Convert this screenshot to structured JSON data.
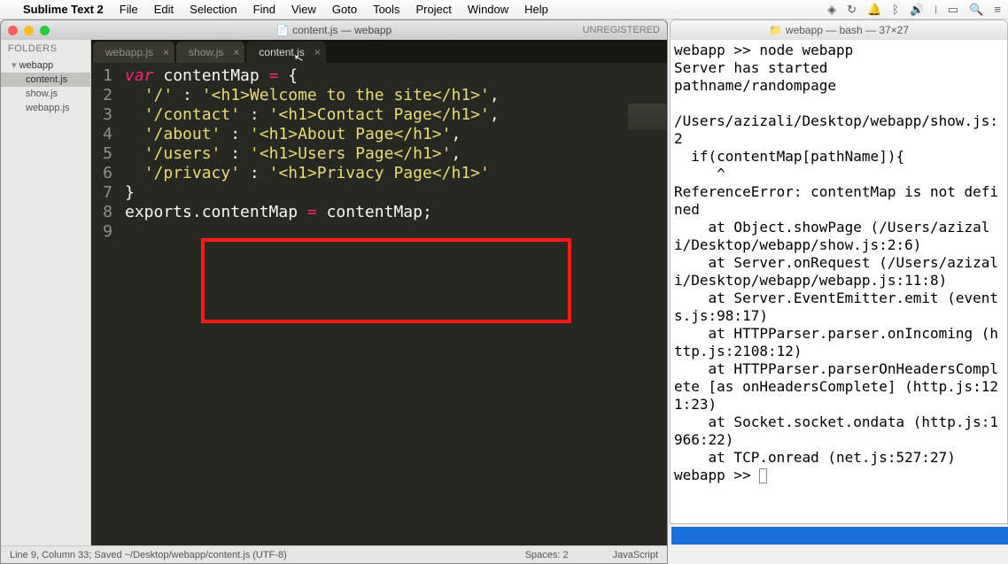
{
  "menubar": {
    "appname": "Sublime Text 2",
    "items": [
      "File",
      "Edit",
      "Selection",
      "Find",
      "View",
      "Goto",
      "Tools",
      "Project",
      "Window",
      "Help"
    ]
  },
  "editor": {
    "title": "content.js — webapp",
    "unregistered": "UNREGISTERED",
    "sidebar": {
      "header": "FOLDERS",
      "folder": "webapp",
      "files": [
        "content.js",
        "show.js",
        "webapp.js"
      ],
      "active_file": "content.js"
    },
    "tabs": [
      {
        "label": "webapp.js",
        "active": false
      },
      {
        "label": "show.js",
        "active": false
      },
      {
        "label": "content.js",
        "active": true
      }
    ],
    "line_numbers": [
      "1",
      "2",
      "3",
      "4",
      "5",
      "6",
      "7",
      "8",
      "9"
    ],
    "code_lines": [
      [
        {
          "c": "kw",
          "t": "var"
        },
        {
          "c": "plain",
          "t": " contentMap "
        },
        {
          "c": "op",
          "t": "="
        },
        {
          "c": "plain",
          "t": " {"
        }
      ],
      [
        {
          "c": "plain",
          "t": "  "
        },
        {
          "c": "str",
          "t": "'/'"
        },
        {
          "c": "plain",
          "t": " : "
        },
        {
          "c": "str",
          "t": "'<h1>Welcome to the site</h1>'"
        },
        {
          "c": "plain",
          "t": ","
        }
      ],
      [
        {
          "c": "plain",
          "t": "  "
        },
        {
          "c": "str",
          "t": "'/contact'"
        },
        {
          "c": "plain",
          "t": " : "
        },
        {
          "c": "str",
          "t": "'<h1>Contact Page</h1>'"
        },
        {
          "c": "plain",
          "t": ","
        }
      ],
      [
        {
          "c": "plain",
          "t": "  "
        },
        {
          "c": "str",
          "t": "'/about'"
        },
        {
          "c": "plain",
          "t": " : "
        },
        {
          "c": "str",
          "t": "'<h1>About Page</h1>'"
        },
        {
          "c": "plain",
          "t": ","
        }
      ],
      [
        {
          "c": "plain",
          "t": "  "
        },
        {
          "c": "str",
          "t": "'/users'"
        },
        {
          "c": "plain",
          "t": " : "
        },
        {
          "c": "str",
          "t": "'<h1>Users Page</h1>'"
        },
        {
          "c": "plain",
          "t": ","
        }
      ],
      [
        {
          "c": "plain",
          "t": "  "
        },
        {
          "c": "str",
          "t": "'/privacy'"
        },
        {
          "c": "plain",
          "t": " : "
        },
        {
          "c": "str",
          "t": "'<h1>Privacy Page</h1>'"
        }
      ],
      [
        {
          "c": "plain",
          "t": "}"
        }
      ],
      [
        {
          "c": "plain",
          "t": ""
        }
      ],
      [
        {
          "c": "plain",
          "t": "exports.contentMap "
        },
        {
          "c": "op",
          "t": "="
        },
        {
          "c": "plain",
          "t": " contentMap;"
        }
      ]
    ],
    "statusbar": {
      "left": "Line 9, Column 33; Saved ~/Desktop/webapp/content.js (UTF-8)",
      "spaces": "Spaces: 2",
      "language": "JavaScript"
    }
  },
  "terminal": {
    "title": "webapp — bash — 37×27",
    "lines": [
      "webapp >> node webapp",
      "Server has started",
      "pathname/randompage",
      "",
      "/Users/azizali/Desktop/webapp/show.js:2",
      "  if(contentMap[pathName]){",
      "     ^",
      "ReferenceError: contentMap is not defined",
      "    at Object.showPage (/Users/azizali/Desktop/webapp/show.js:2:6)",
      "    at Server.onRequest (/Users/azizali/Desktop/webapp/webapp.js:11:8)",
      "    at Server.EventEmitter.emit (events.js:98:17)",
      "    at HTTPParser.parser.onIncoming (http.js:2108:12)",
      "    at HTTPParser.parserOnHeadersComplete [as onHeadersComplete] (http.js:121:23)",
      "    at Socket.socket.ondata (http.js:1966:22)",
      "    at TCP.onread (net.js:527:27)"
    ],
    "prompt": "webapp >> "
  }
}
